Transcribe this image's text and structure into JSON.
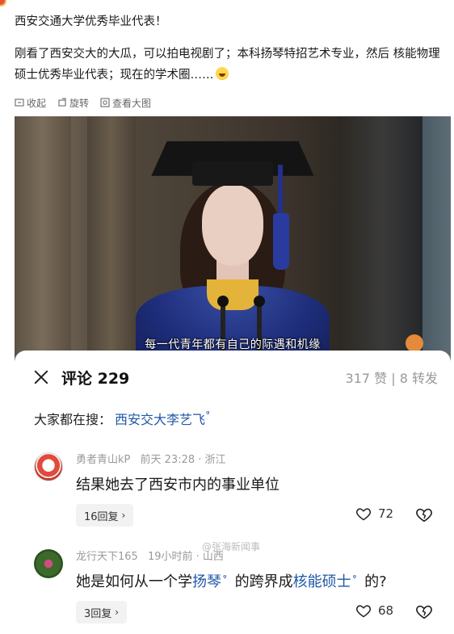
{
  "post": {
    "line1": "西安交通大学优秀毕业代表！",
    "body": "刚看了西安交大的大瓜，可以拍电视剧了；本科扬琴特招艺术专业，然后 核能物理硕士优秀毕业代表；现在的学术圈……"
  },
  "actions": {
    "collect": "收起",
    "rotate": "旋转",
    "view_large": "查看大图"
  },
  "video": {
    "subtitle": "每一代青年都有自己的际遇和机缘"
  },
  "comments_panel": {
    "title": "评论 229",
    "stats": "317 赞 | 8 转发",
    "search_label": "大家都在搜：",
    "search_term": "西安交大李艺飞",
    "search_mark": "ᵠ",
    "watermark": "@张海新闻事"
  },
  "comments": [
    {
      "name": "勇者青山kP",
      "time": "前天 23:28",
      "location": "· 浙江",
      "text": "结果她去了西安市内的事业单位",
      "replies": "16回复",
      "likes": "72"
    },
    {
      "name": "龙行天下165",
      "time": "19小时前",
      "location": "· 山西",
      "text_a": "她是如何从一个学",
      "text_hl1": "扬琴",
      "text_b": "的跨界成",
      "text_hl2": "核能硕士",
      "text_c": "的?",
      "replies": "3回复",
      "likes": "68"
    }
  ],
  "icons": {
    "chevron": "›",
    "query_mark": "ᵠ"
  }
}
